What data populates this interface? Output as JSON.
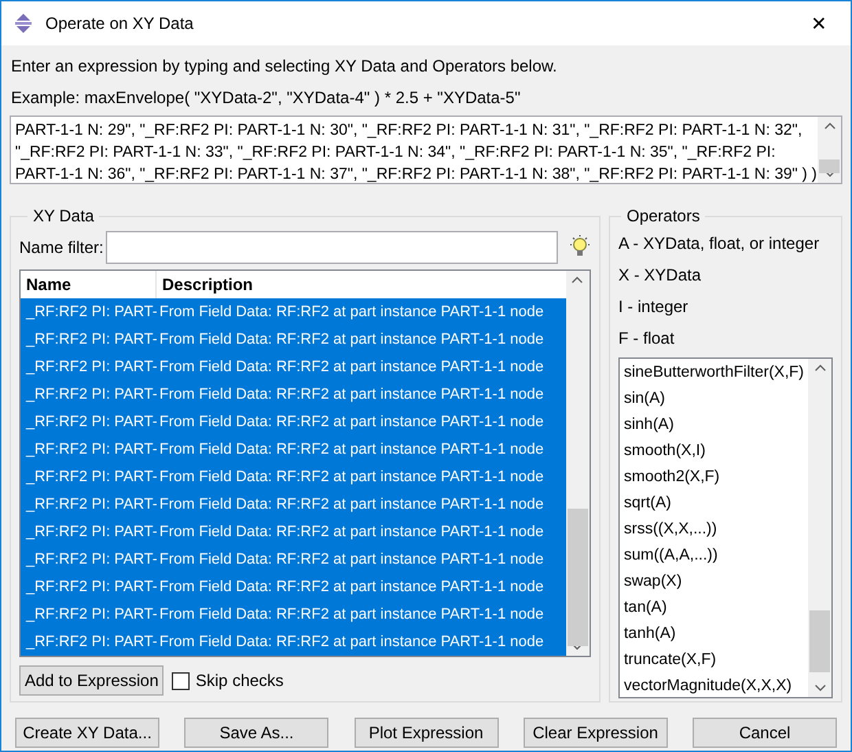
{
  "window": {
    "title": "Operate on XY Data",
    "close": "✕"
  },
  "instructions": [
    "Enter an expression by typing and selecting XY Data and Operators below.",
    "Example: maxEnvelope( \"XYData-2\", \"XYData-4\" ) * 2.5 + \"XYData-5\""
  ],
  "expression": {
    "lines": [
      "PART-1-1 N: 29\", \"_RF:RF2 PI: PART-1-1 N: 30\", \"_RF:RF2 PI: PART-1-1 N: 31\", \"_RF:RF2 PI: PART-1-1 N: 32\",",
      "\"_RF:RF2 PI: PART-1-1 N: 33\", \"_RF:RF2 PI: PART-1-1 N: 34\", \"_RF:RF2 PI: PART-1-1 N: 35\", \"_RF:RF2 PI:",
      "PART-1-1 N: 36\", \"_RF:RF2 PI: PART-1-1 N: 37\", \"_RF:RF2 PI: PART-1-1 N: 38\", \"_RF:RF2 PI: PART-1-1 N: 39\" ) )"
    ]
  },
  "xy_data": {
    "title": "XY Data",
    "filter_label": "Name filter:",
    "columns": [
      "Name",
      "Description"
    ],
    "rows": [
      {
        "name": "_RF:RF2 PI: PART-",
        "description": "From Field Data: RF:RF2  at part instance PART-1-1 node",
        "selected": true
      },
      {
        "name": "_RF:RF2 PI: PART-",
        "description": "From Field Data: RF:RF2  at part instance PART-1-1 node",
        "selected": true
      },
      {
        "name": "_RF:RF2 PI: PART-",
        "description": "From Field Data: RF:RF2  at part instance PART-1-1 node",
        "selected": true
      },
      {
        "name": "_RF:RF2 PI: PART-",
        "description": "From Field Data: RF:RF2  at part instance PART-1-1 node",
        "selected": true
      },
      {
        "name": "_RF:RF2 PI: PART-",
        "description": "From Field Data: RF:RF2  at part instance PART-1-1 node",
        "selected": true
      },
      {
        "name": "_RF:RF2 PI: PART-",
        "description": "From Field Data: RF:RF2  at part instance PART-1-1 node",
        "selected": true
      },
      {
        "name": "_RF:RF2 PI: PART-",
        "description": "From Field Data: RF:RF2  at part instance PART-1-1 node",
        "selected": true
      },
      {
        "name": "_RF:RF2 PI: PART-",
        "description": "From Field Data: RF:RF2  at part instance PART-1-1 node",
        "selected": true
      },
      {
        "name": "_RF:RF2 PI: PART-",
        "description": "From Field Data: RF:RF2  at part instance PART-1-1 node",
        "selected": true
      },
      {
        "name": "_RF:RF2 PI: PART-",
        "description": "From Field Data: RF:RF2  at part instance PART-1-1 node",
        "selected": true
      },
      {
        "name": "_RF:RF2 PI: PART-",
        "description": "From Field Data: RF:RF2  at part instance PART-1-1 node",
        "selected": true
      },
      {
        "name": "_RF:RF2 PI: PART-",
        "description": "From Field Data: RF:RF2  at part instance PART-1-1 node",
        "selected": true
      },
      {
        "name": "_RF:RF2 PI: PART-",
        "description": "From Field Data: RF:RF2  at part instance PART-1-1 node",
        "selected": true
      }
    ],
    "add_button": "Add to Expression",
    "skip_checks": {
      "label": "Skip checks",
      "checked": false
    }
  },
  "operators": {
    "title": "Operators",
    "legend": [
      "A - XYData, float, or integer",
      "X - XYData",
      "I - integer",
      "F - float"
    ],
    "items": [
      "sineButterworthFilter(X,F)",
      "sin(A)",
      "sinh(A)",
      "smooth(X,I)",
      "smooth2(X,F)",
      "sqrt(A)",
      "srss((X,X,...))",
      "sum((A,A,...))",
      "swap(X)",
      "tan(A)",
      "tanh(A)",
      "truncate(X,F)",
      "vectorMagnitude(X,X,X)"
    ]
  },
  "buttons": [
    "Create XY Data...",
    "Save As...",
    "Plot Expression",
    "Clear Expression",
    "Cancel"
  ]
}
